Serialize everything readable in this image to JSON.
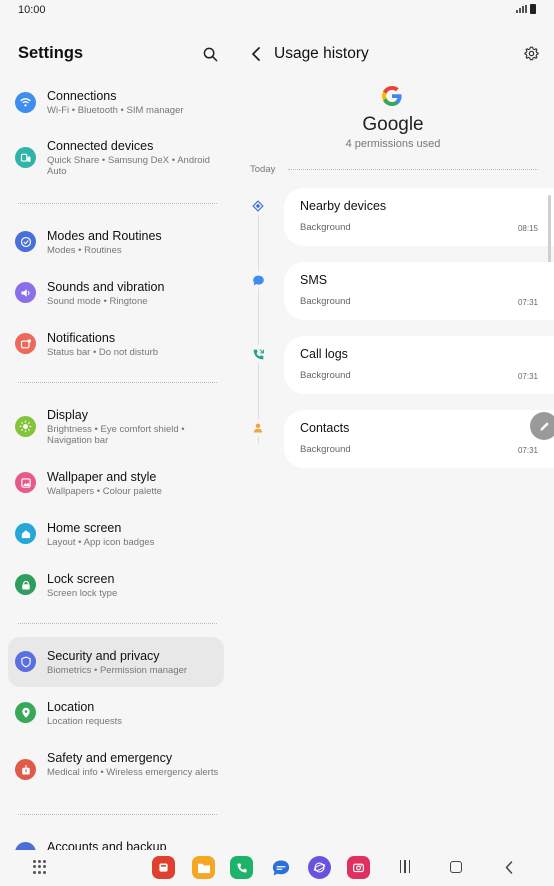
{
  "status_bar": {
    "time": "10:00"
  },
  "settings": {
    "title": "Settings",
    "items": [
      {
        "title": "Connections",
        "sub": "Wi-Fi  •  Bluetooth  •  SIM manager",
        "icon": "wifi-icon",
        "color": "#3d8ef0"
      },
      {
        "title": "Connected devices",
        "sub": "Quick Share  •  Samsung DeX  •  Android Auto",
        "icon": "connected-devices-icon",
        "color": "#2eb5a7"
      },
      {
        "title": "Modes and Routines",
        "sub": "Modes  •  Routines",
        "icon": "check-circle-icon",
        "color": "#4a6fd8"
      },
      {
        "title": "Sounds and vibration",
        "sub": "Sound mode  •  Ringtone",
        "icon": "speaker-icon",
        "color": "#8b6ee8"
      },
      {
        "title": "Notifications",
        "sub": "Status bar  •  Do not disturb",
        "icon": "notification-icon",
        "color": "#ec6a5c"
      },
      {
        "title": "Display",
        "sub": "Brightness  •  Eye comfort shield  •  Navigation bar",
        "icon": "sun-icon",
        "color": "#84c43b"
      },
      {
        "title": "Wallpaper and style",
        "sub": "Wallpapers  •  Colour palette",
        "icon": "wallpaper-icon",
        "color": "#e65b8c"
      },
      {
        "title": "Home screen",
        "sub": "Layout  •  App icon badges",
        "icon": "home-icon",
        "color": "#25a8d8"
      },
      {
        "title": "Lock screen",
        "sub": "Screen lock type",
        "icon": "lock-icon",
        "color": "#2e9e5e"
      },
      {
        "title": "Security and privacy",
        "sub": "Biometrics  •  Permission manager",
        "icon": "shield-icon",
        "color": "#5a6fe0"
      },
      {
        "title": "Location",
        "sub": "Location requests",
        "icon": "location-pin-icon",
        "color": "#3aa85a"
      },
      {
        "title": "Safety and emergency",
        "sub": "Medical info  •  Wireless emergency alerts",
        "icon": "emergency-icon",
        "color": "#e05a4a"
      },
      {
        "title": "Accounts and backup",
        "sub": "",
        "icon": "account-icon",
        "color": "#4a6fd8"
      }
    ]
  },
  "usage": {
    "title": "Usage history",
    "app_name": "Google",
    "permissions_used": "4 permissions used",
    "section": "Today",
    "entries": [
      {
        "title": "Nearby devices",
        "sub": "Background",
        "time": "08:15",
        "icon": "nearby-devices-icon",
        "color": "#3d6fe0"
      },
      {
        "title": "SMS",
        "sub": "Background",
        "time": "07:31",
        "icon": "sms-icon",
        "color": "#3d8ef0"
      },
      {
        "title": "Call logs",
        "sub": "Background",
        "time": "07:31",
        "icon": "call-log-icon",
        "color": "#1fa58a"
      },
      {
        "title": "Contacts",
        "sub": "Background",
        "time": "07:31",
        "icon": "contact-icon",
        "color": "#f0a640"
      }
    ]
  },
  "dock": [
    {
      "icon": "slides-app-icon",
      "color": "#e0402f"
    },
    {
      "icon": "files-app-icon",
      "color": "#f5a623"
    },
    {
      "icon": "phone-app-icon",
      "color": "#1db36b"
    },
    {
      "icon": "messages-app-icon",
      "color": "#2a6fdb"
    },
    {
      "icon": "internet-app-icon",
      "color": "#6a52e0"
    },
    {
      "icon": "camera-app-icon",
      "color": "#e0305f"
    }
  ]
}
